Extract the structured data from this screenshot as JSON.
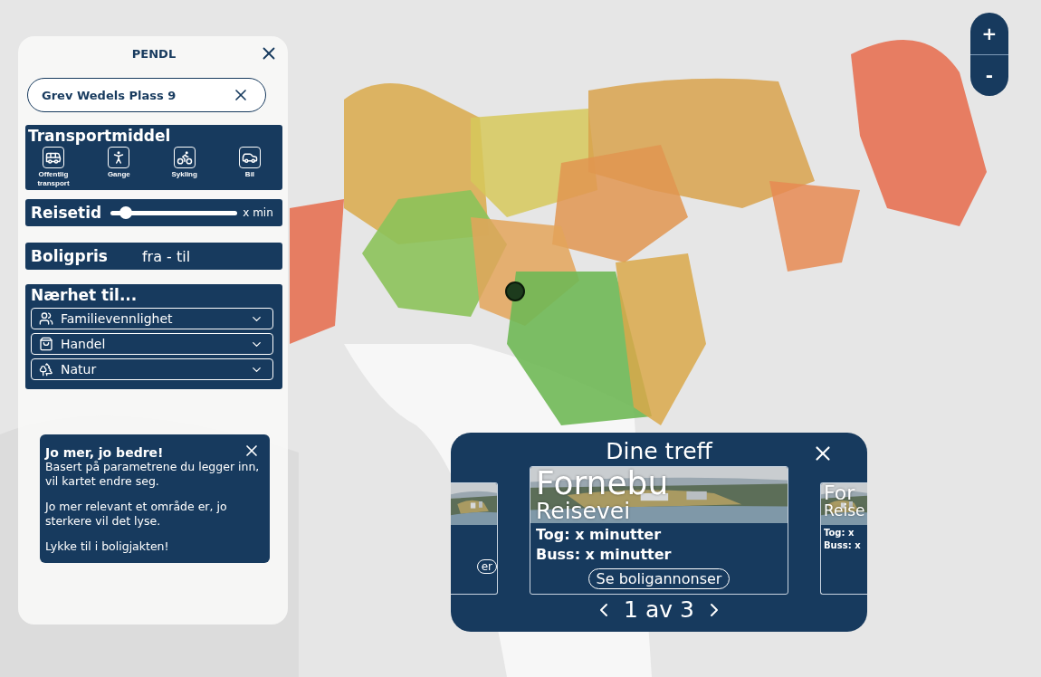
{
  "app": {
    "title": "PENDL"
  },
  "address": {
    "value": "Grev Wedels Plass 9"
  },
  "transport": {
    "title": "Transportmiddel",
    "modes": [
      {
        "kind": "transit",
        "label": "Offentlig transport"
      },
      {
        "kind": "walk",
        "label": "Gange"
      },
      {
        "kind": "bike",
        "label": "Sykling"
      },
      {
        "kind": "car",
        "label": "Bil"
      }
    ]
  },
  "travel_time": {
    "label": "Reisetid",
    "level": 0.12,
    "reading": "x min"
  },
  "price": {
    "label": "Boligpris",
    "value": "fra - til"
  },
  "proximity": {
    "title": "Nærhet til...",
    "options": [
      {
        "kind": "family",
        "label": "Familievennlighet"
      },
      {
        "kind": "shopping",
        "label": "Handel"
      },
      {
        "kind": "nature",
        "label": "Natur"
      }
    ]
  },
  "tip": {
    "title": "Jo mer, jo bedre!",
    "paragraphs": [
      "Basert på parametrene du legger inn, vil kartet endre seg.",
      "Jo mer relevant et område er, jo sterkere vil det lyse.",
      "Lykke til i boligjakten!"
    ]
  },
  "results": {
    "title": "Dine treff",
    "cards": [
      {
        "kind": "peek_left",
        "button": "er"
      },
      {
        "kind": "main",
        "title": "Fornebu",
        "subtitle": "Reisevei",
        "lines": [
          "Tog: x minutter",
          "Buss: x minutter"
        ],
        "button": "Se boligannonser"
      },
      {
        "kind": "peek_right",
        "title": "For",
        "subtitle": "Reise",
        "lines": [
          "Tog: x",
          "Buss: x"
        ]
      }
    ],
    "pager": "1 av 3"
  },
  "zoom": {
    "in": "+",
    "out": "-"
  }
}
